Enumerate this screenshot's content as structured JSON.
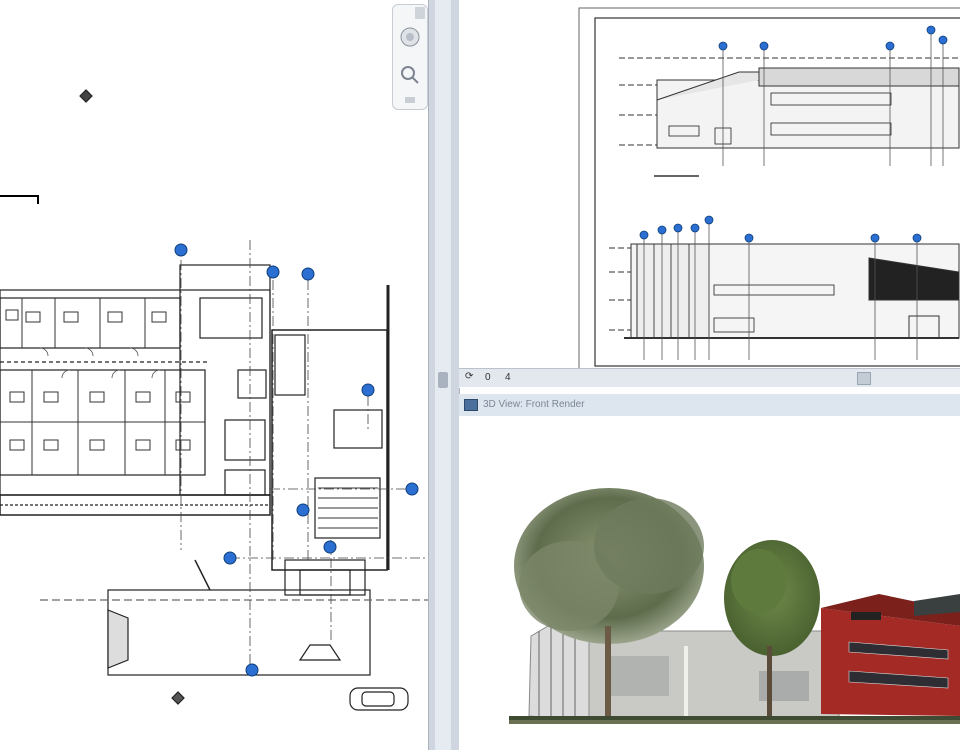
{
  "elevation_view": {
    "scale_label": "",
    "status_items": [
      "⟳",
      "0",
      "4"
    ]
  },
  "render_view": {
    "title": "3D View: Front Render",
    "scale_label": "",
    "building_sign": ""
  },
  "colors": {
    "accent": "#1f6fd6",
    "splitter": "#cfd6df",
    "brick": "#a32a25",
    "foliage": "#6b7f55"
  },
  "icons": {
    "nav_orbit": "orbit-icon",
    "nav_zoom": "zoom-icon",
    "view_cube": "view-cube-icon",
    "render_view": "render-view-icon"
  }
}
